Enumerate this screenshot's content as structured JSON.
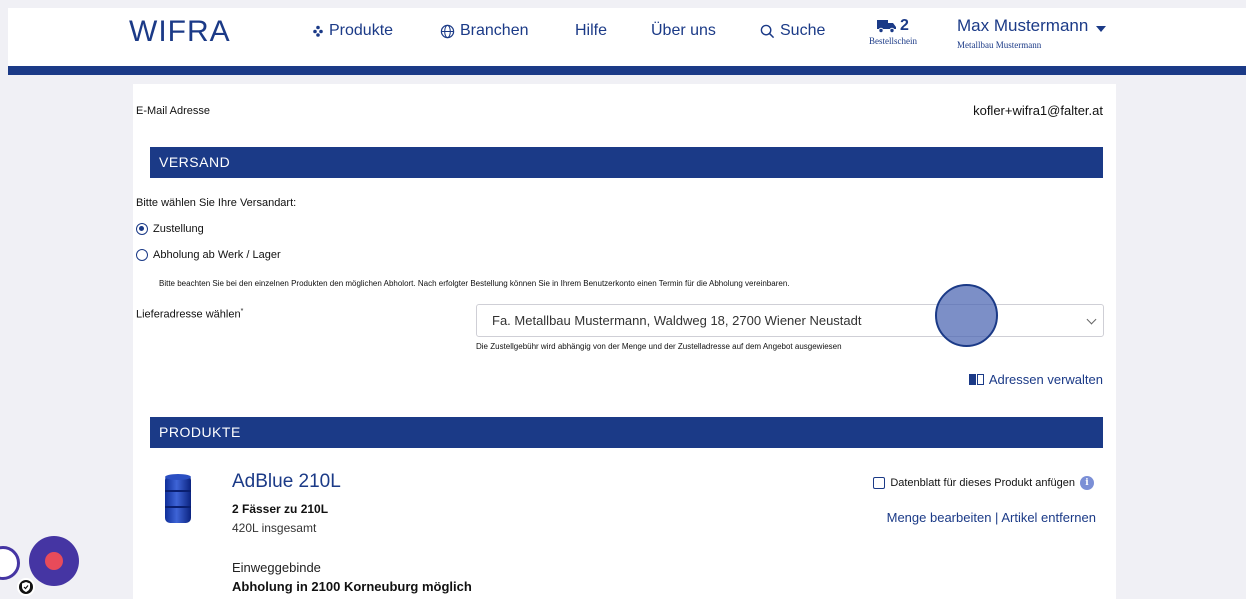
{
  "header": {
    "logo": "WIFRA",
    "nav": {
      "produkte": "Produkte",
      "branchen": "Branchen",
      "hilfe": "Hilfe",
      "ueber_uns": "Über uns",
      "suche": "Suche"
    },
    "cart": {
      "count": "2",
      "label": "Bestellschein"
    },
    "user": {
      "name": "Max Mustermann",
      "company": "Metallbau Mustermann"
    }
  },
  "account": {
    "email_label": "E-Mail Adresse",
    "email_value": "kofler+wifra1@falter.at"
  },
  "versand": {
    "heading": "VERSAND",
    "prompt": "Bitte wählen Sie Ihre Versandart:",
    "options": [
      {
        "label": "Zustellung",
        "selected": true
      },
      {
        "label": "Abholung ab Werk / Lager",
        "selected": false
      }
    ],
    "note": "Bitte beachten Sie bei den einzelnen Produkten den möglichen Abholort. Nach erfolgter Bestellung können Sie in Ihrem Benutzerkonto einen Termin für die Abholung vereinbaren.",
    "address_label": "Lieferadresse wählen",
    "address_required_mark": "*",
    "address_selected": "Fa. Metallbau Mustermann, Waldweg 18, 2700 Wiener Neustadt",
    "address_help": "Die Zustellgebühr wird abhängig von der Menge und der Zustelladresse auf dem Angebot ausgewiesen",
    "manage_addresses": "Adressen verwalten"
  },
  "produkte": {
    "heading": "PRODUKTE",
    "items": [
      {
        "title": "AdBlue 210L",
        "quantity": "2 Fässer zu 210L",
        "total": "420L insgesamt",
        "packaging": "Einweggebinde",
        "pickup": "Abholung in 2100 Korneuburg möglich",
        "datasheet_label": "Datenblatt für dieses Produkt anfügen",
        "info_glyph": "i",
        "edit_label": "Menge bearbeiten",
        "separator": " | ",
        "remove_label": "Artikel entfernen"
      }
    ]
  },
  "colors": {
    "brand": "#1b3a87",
    "page_bg": "#f0f0f5",
    "fab": "#4535a3",
    "fab_dot": "#e84b5a"
  }
}
